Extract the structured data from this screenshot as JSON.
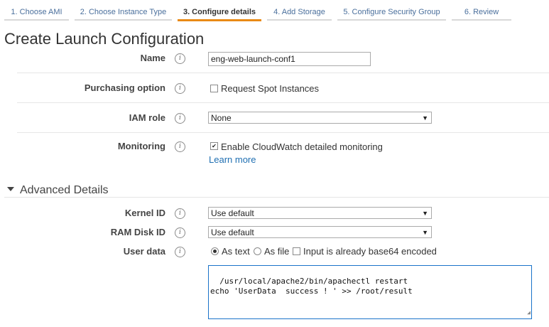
{
  "wizard": {
    "steps": [
      {
        "label": "1. Choose AMI"
      },
      {
        "label": "2. Choose Instance Type"
      },
      {
        "label": "3. Configure details"
      },
      {
        "label": "4. Add Storage"
      },
      {
        "label": "5. Configure Security Group"
      },
      {
        "label": "6. Review"
      }
    ],
    "active_step": 3
  },
  "page": {
    "title": "Create Launch Configuration"
  },
  "form": {
    "name": {
      "label": "Name",
      "value": "eng-web-launch-conf1"
    },
    "purchasing": {
      "label": "Purchasing option",
      "checkbox_label": "Request Spot Instances",
      "checked": false
    },
    "iam": {
      "label": "IAM role",
      "value": "None"
    },
    "monitoring": {
      "label": "Monitoring",
      "checkbox_label": "Enable CloudWatch detailed monitoring",
      "checked": true,
      "link": "Learn more"
    }
  },
  "advanced": {
    "title": "Advanced Details",
    "kernel": {
      "label": "Kernel ID",
      "value": "Use default"
    },
    "ramdisk": {
      "label": "RAM Disk ID",
      "value": "Use default"
    },
    "userdata": {
      "label": "User data",
      "as_text": "As text",
      "as_file": "As file",
      "base64_label": "Input is already base64 encoded",
      "selected": "As text",
      "content": "/usr/local/apache2/bin/apachectl restart\necho 'UserData  success ! ' >> /root/result"
    }
  },
  "icons": {
    "info": "i",
    "dropdown": "▼",
    "check": "✔",
    "grip": "◢"
  },
  "colors": {
    "accent": "#e98a15",
    "link": "#1f6fb2",
    "focus_border": "#1a73c9"
  }
}
